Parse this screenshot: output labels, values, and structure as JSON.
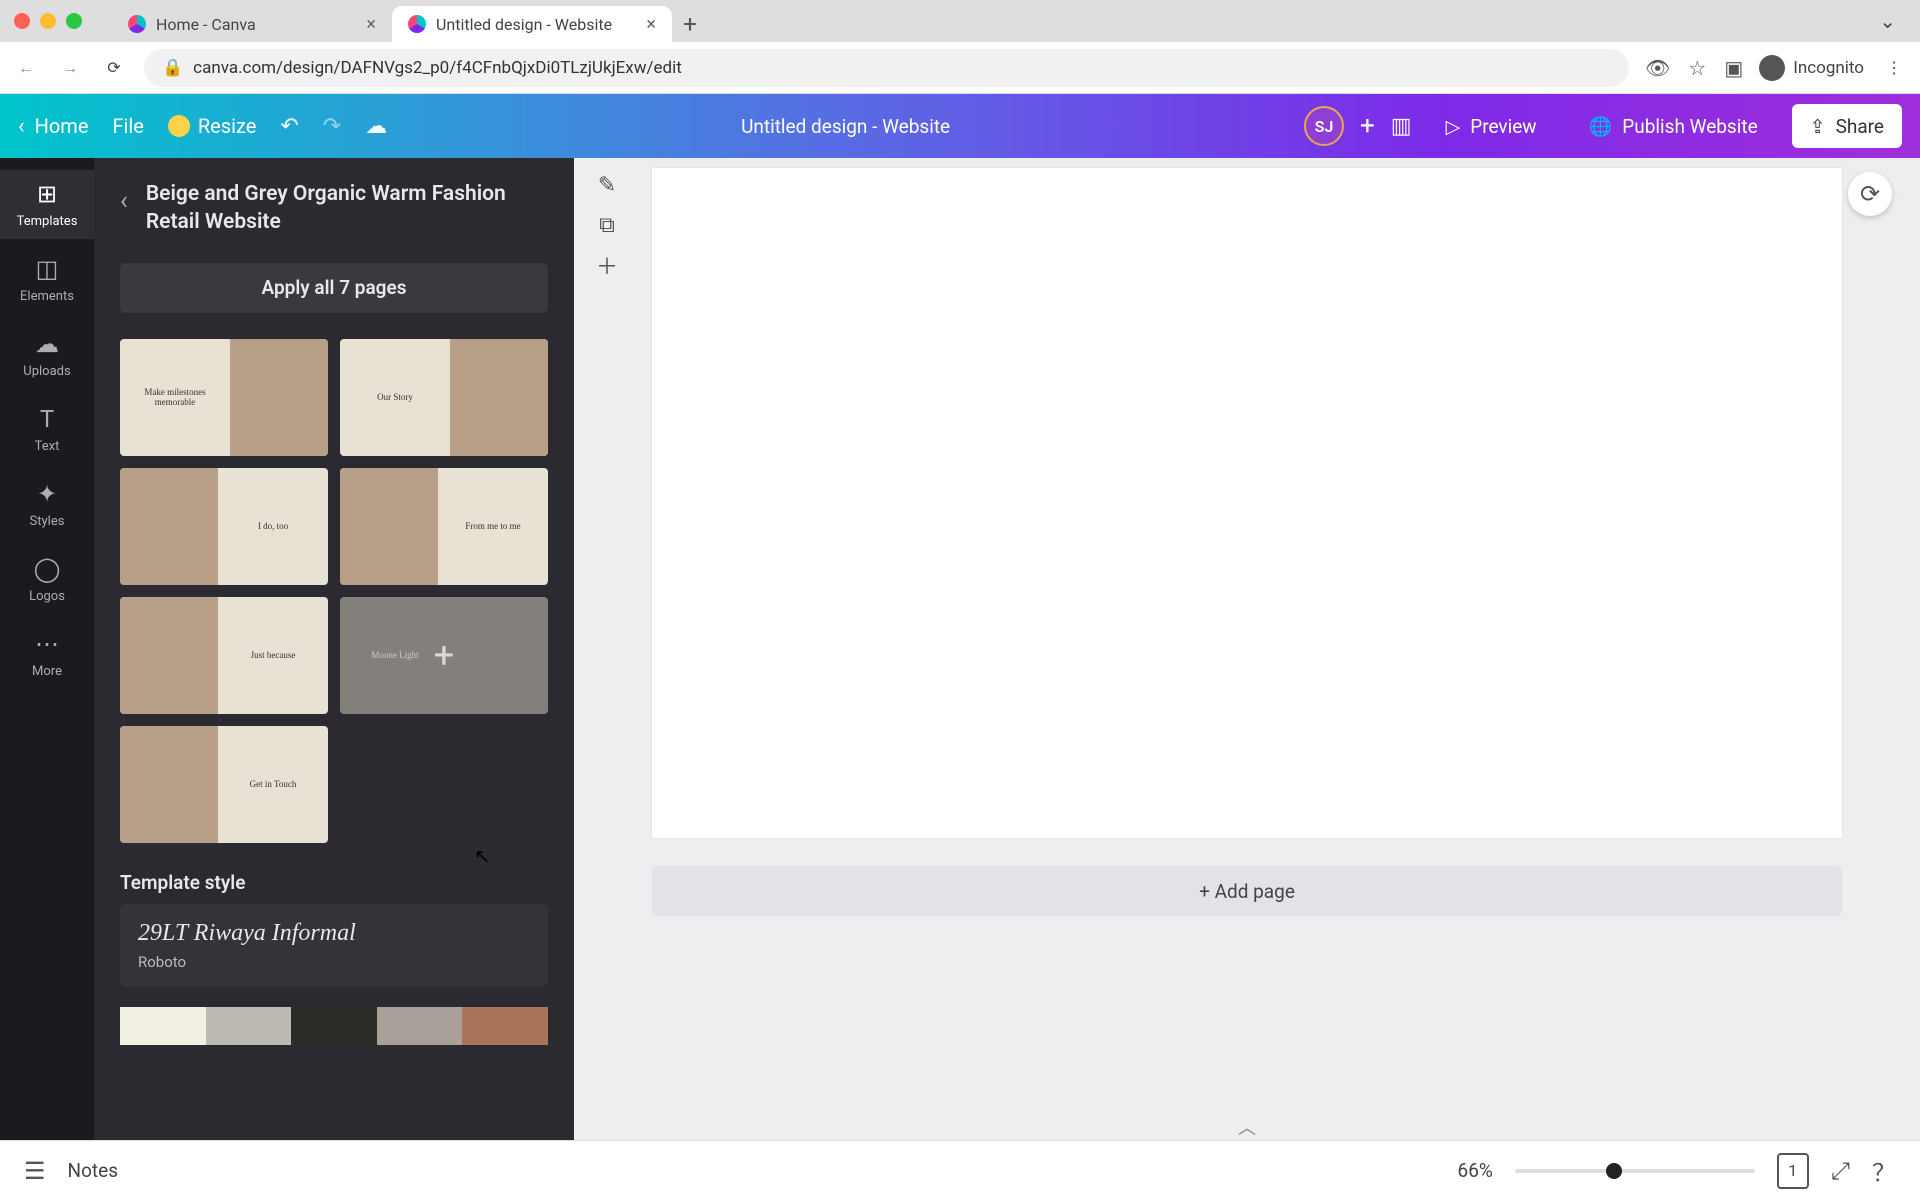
{
  "browser": {
    "tabs": [
      {
        "title": "Home - Canva",
        "active": false
      },
      {
        "title": "Untitled design - Website",
        "active": true
      }
    ],
    "url": "canva.com/design/DAFNVgs2_p0/f4CFnbQjxDi0TLzjUkjExw/edit",
    "profile_label": "Incognito"
  },
  "toolbar": {
    "home_label": "Home",
    "file_label": "File",
    "resize_label": "Resize",
    "design_title": "Untitled design - Website",
    "avatar_initials": "SJ",
    "preview_label": "Preview",
    "publish_label": "Publish Website",
    "share_label": "Share"
  },
  "rail": {
    "items": [
      {
        "icon": "⊞",
        "label": "Templates"
      },
      {
        "icon": "◫",
        "label": "Elements"
      },
      {
        "icon": "☁",
        "label": "Uploads"
      },
      {
        "icon": "T",
        "label": "Text"
      },
      {
        "icon": "✦",
        "label": "Styles"
      },
      {
        "icon": "◯",
        "label": "Logos"
      },
      {
        "icon": "⋯",
        "label": "More"
      }
    ]
  },
  "panel": {
    "template_title": "Beige and Grey Organic Warm Fashion Retail Website",
    "apply_label": "Apply all 7 pages",
    "thumbs": [
      {
        "caption": "Make milestones memorable"
      },
      {
        "caption": "Our Story"
      },
      {
        "caption": "I do, too"
      },
      {
        "caption": "From me to me"
      },
      {
        "caption": "Just because"
      },
      {
        "caption": "Moone Light"
      },
      {
        "caption": "Get in Touch"
      }
    ],
    "style_heading": "Template style",
    "font_primary": "29LT Riwaya Informal",
    "font_secondary": "Roboto",
    "palette": [
      "#f2efe4",
      "#bdbab3",
      "#2d2b28",
      "#a9a199",
      "#a9745a"
    ]
  },
  "canvas": {
    "add_page_label": "+ Add page"
  },
  "footer": {
    "notes_label": "Notes",
    "zoom_label": "66%",
    "zoom_value_pct": 38,
    "page_indicator": "1"
  }
}
